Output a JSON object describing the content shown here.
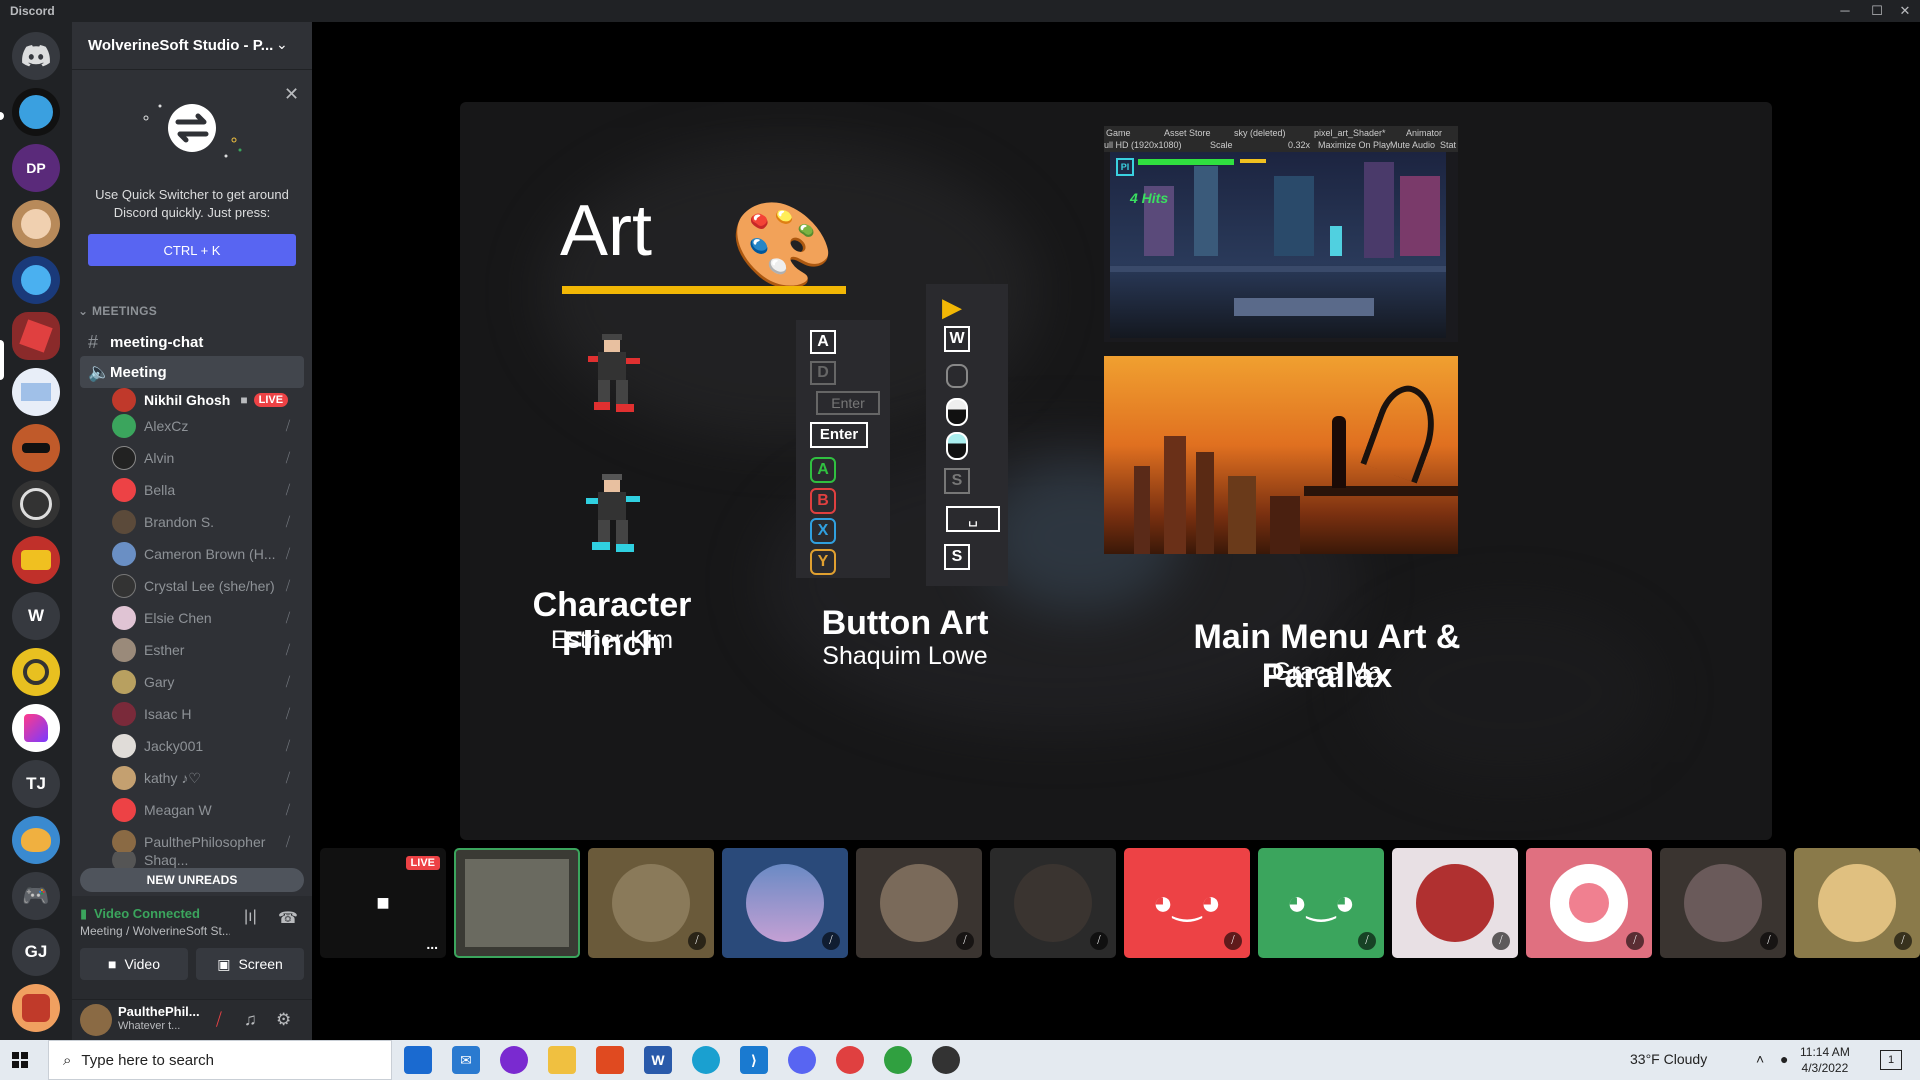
{
  "window": {
    "app_name": "Discord",
    "controls": {
      "minimize": "─",
      "maximize": "☐",
      "close": "✕"
    }
  },
  "rail": {
    "servers": [
      {
        "name": "home",
        "initials": ""
      },
      {
        "name": "server-1",
        "initials": ""
      },
      {
        "name": "server-dp",
        "initials": "DP"
      },
      {
        "name": "server-3",
        "initials": ""
      },
      {
        "name": "server-4",
        "initials": ""
      },
      {
        "name": "server-5",
        "initials": ""
      },
      {
        "name": "server-6",
        "initials": ""
      },
      {
        "name": "server-7",
        "initials": ""
      },
      {
        "name": "server-8",
        "initials": ""
      },
      {
        "name": "server-9",
        "initials": ""
      },
      {
        "name": "server-w",
        "initials": "W"
      },
      {
        "name": "server-11",
        "initials": ""
      },
      {
        "name": "server-12",
        "initials": ""
      },
      {
        "name": "server-tj",
        "initials": "TJ"
      },
      {
        "name": "server-14",
        "initials": ""
      },
      {
        "name": "server-15",
        "initials": ""
      },
      {
        "name": "server-gj",
        "initials": "GJ"
      },
      {
        "name": "server-17",
        "initials": ""
      }
    ]
  },
  "sidebar": {
    "guild_name": "WolverineSoft Studio - P...",
    "quick_switcher": {
      "text": "Use Quick Switcher to get around Discord quickly. Just press:",
      "shortcut": "CTRL + K"
    },
    "category": "MEETINGS",
    "channels": [
      {
        "name": "meeting-chat",
        "type": "text"
      },
      {
        "name": "Meeting",
        "type": "voice"
      }
    ],
    "live_badge": "LIVE",
    "voice_users": [
      {
        "name": "Nikhil Ghosh",
        "avatar_color": "#c0392b"
      },
      {
        "name": "AlexCz",
        "avatar_color": "#3ba55d"
      },
      {
        "name": "Alvin",
        "avatar_color": "#222"
      },
      {
        "name": "Bella",
        "avatar_color": "#ed4245"
      },
      {
        "name": "Brandon S.",
        "avatar_color": "#5b4a3a"
      },
      {
        "name": "Cameron Brown (H...",
        "avatar_color": "#6a8fc4"
      },
      {
        "name": "Crystal Lee (she/her)",
        "avatar_color": "#333"
      },
      {
        "name": "Elsie Chen",
        "avatar_color": "#e0c4d4"
      },
      {
        "name": "Esther",
        "avatar_color": "#9a8a7a"
      },
      {
        "name": "Gary",
        "avatar_color": "#b8a060"
      },
      {
        "name": "Isaac H",
        "avatar_color": "#7a2a3a"
      },
      {
        "name": "Jacky001",
        "avatar_color": "#e0dcd8"
      },
      {
        "name": "kathy ♪♡",
        "avatar_color": "#c4a070"
      },
      {
        "name": "Meagan W",
        "avatar_color": "#ed4245"
      },
      {
        "name": "PaulthePhilosopher",
        "avatar_color": "#8a6a44"
      },
      {
        "name": "Shaq...",
        "avatar_color": "#555"
      }
    ],
    "new_unreads": "NEW UNREADS",
    "voice_panel": {
      "status": "Video Connected",
      "location": "Meeting / WolverineSoft St...",
      "video_label": "Video",
      "screen_label": "Screen"
    },
    "user": {
      "name": "PaulthePhil...",
      "status": "Whatever t..."
    }
  },
  "stream": {
    "art_title": "Art",
    "columns": [
      {
        "title": "Character Flinch",
        "author": "Esther Kim"
      },
      {
        "title": "Button Art",
        "author": "Shaquim Lowe"
      },
      {
        "title": "Main Menu Art & Parallax",
        "author": "Grace Ma"
      }
    ],
    "buttons_left": [
      "A",
      "D",
      "Enter",
      "Enter",
      "A",
      "B",
      "X",
      "Y"
    ],
    "buttons_right": [
      "▶",
      "W",
      "",
      "",
      "",
      "S",
      "␣",
      "S"
    ],
    "unity": {
      "tabs": [
        "Game",
        "Asset Store",
        "sky (deleted)",
        "pixel_art_Shader*",
        "Animator"
      ],
      "toolbar": [
        "ull HD (1920x1080)",
        "Scale",
        "0.32x",
        "Maximize On Play",
        "Mute Audio",
        "Stat"
      ],
      "game_hud": {
        "pl": "PI",
        "hits": "4 Hits"
      }
    }
  },
  "tiles": {
    "live_badge": "LIVE",
    "more": "..."
  },
  "taskbar": {
    "search_placeholder": "Type here to search",
    "weather": "33°F  Cloudy",
    "time": "11:14 AM",
    "date": "4/3/2022",
    "notifications": "1"
  }
}
